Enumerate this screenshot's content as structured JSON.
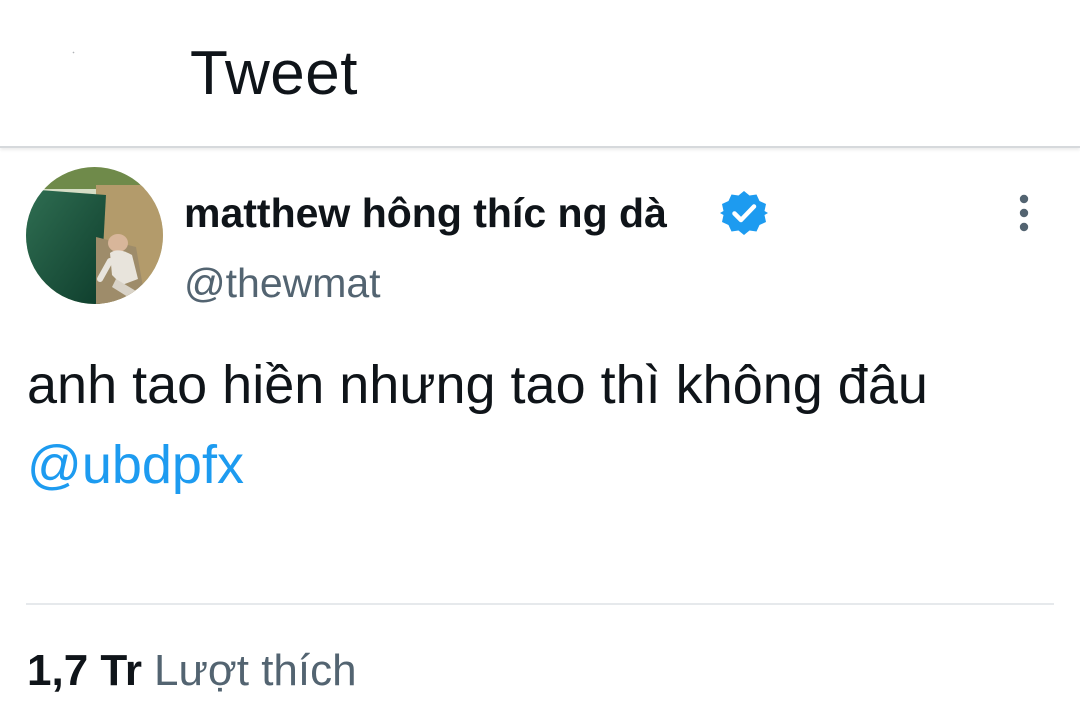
{
  "header": {
    "title": "Tweet",
    "back_icon": "back-arrow-icon"
  },
  "tweet": {
    "author": {
      "display_name": "matthew hông thíc ng dà",
      "username": "@thewmat",
      "verified": true,
      "verified_icon": "verified-badge-icon",
      "avatar": "profile-photo"
    },
    "more_icon": "more-vertical-icon",
    "text": "anh tao hiền nhưng tao thì không đâu",
    "mention": "@ubdpfx"
  },
  "stats": {
    "likes_count": "1,7 Tr",
    "likes_label": "Lượt thích"
  },
  "colors": {
    "text_primary": "#0f1419",
    "text_secondary": "#536471",
    "link": "#1d9bf0",
    "verified": "#1d9bf0",
    "divider": "#e6e9ec"
  }
}
